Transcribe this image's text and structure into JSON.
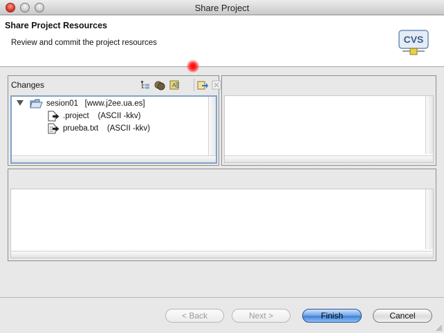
{
  "window": {
    "title": "Share Project"
  },
  "header": {
    "title": "Share Project Resources",
    "description": "Review and commit the project resources",
    "logo_text": "CVS"
  },
  "changes_pane": {
    "title": "Changes",
    "toolbar_icons": [
      "tree-layout-icon",
      "group-icon",
      "sort-icon",
      "commit-icon",
      "remove-icon"
    ],
    "tree": [
      {
        "label": "sesion01   [www.j2ee.ua.es]",
        "expanded": true,
        "icon": "folder-icon"
      },
      {
        "label": ".project    (ASCII -kkv)",
        "icon": "outgoing-file-icon"
      },
      {
        "label": "prueba.txt    (ASCII -kkv)",
        "icon": "outgoing-text-file-icon"
      }
    ]
  },
  "buttons": {
    "back": "< Back",
    "next": "Next >",
    "finish": "Finish",
    "cancel": "Cancel"
  },
  "colors": {
    "selection_border": "#7fa3c9",
    "default_button": "#3d7fd6",
    "close_button": "#d8322a"
  }
}
